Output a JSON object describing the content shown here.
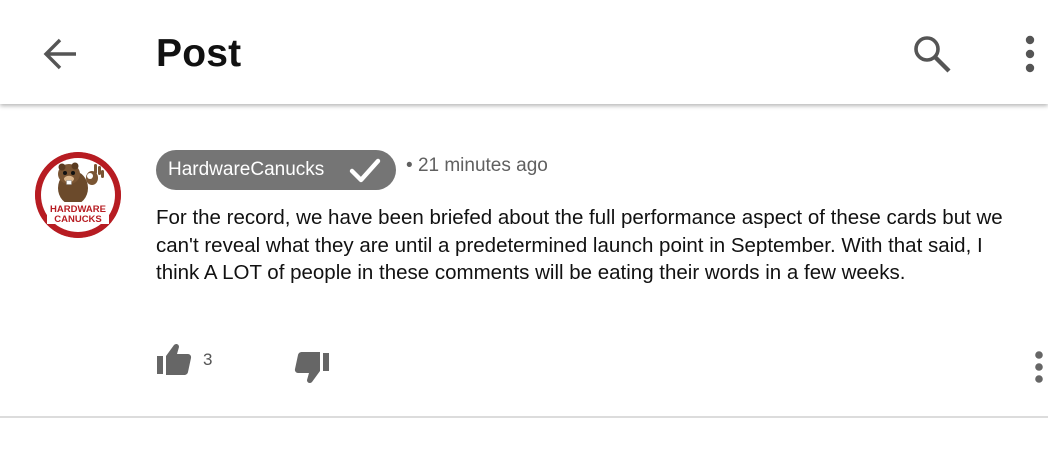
{
  "header": {
    "title": "Post",
    "back_icon": "arrow-back-icon",
    "search_icon": "search-icon",
    "more_icon": "more-vert-icon"
  },
  "comment": {
    "author": "HardwareCanucks",
    "author_verified": true,
    "avatar": {
      "text_line1": "HARDWARE",
      "text_line2": "CANUCKS",
      "bg_color": "#b71c22"
    },
    "time_separator": "•",
    "time": "21 minutes ago",
    "body": "For the record, we have been briefed about the full performance aspect of these cards but we can't reveal what they are until a predetermined launch point in September.  With that said, I think A LOT of people in these comments will be eating their words in a few weeks.",
    "like_count": "3",
    "like_icon": "thumb-up-icon",
    "dislike_icon": "thumb-down-icon",
    "more_icon": "more-vert-icon"
  },
  "colors": {
    "chip_bg": "#757575",
    "icon_gray": "#666666",
    "divider": "#dcdcdc"
  }
}
